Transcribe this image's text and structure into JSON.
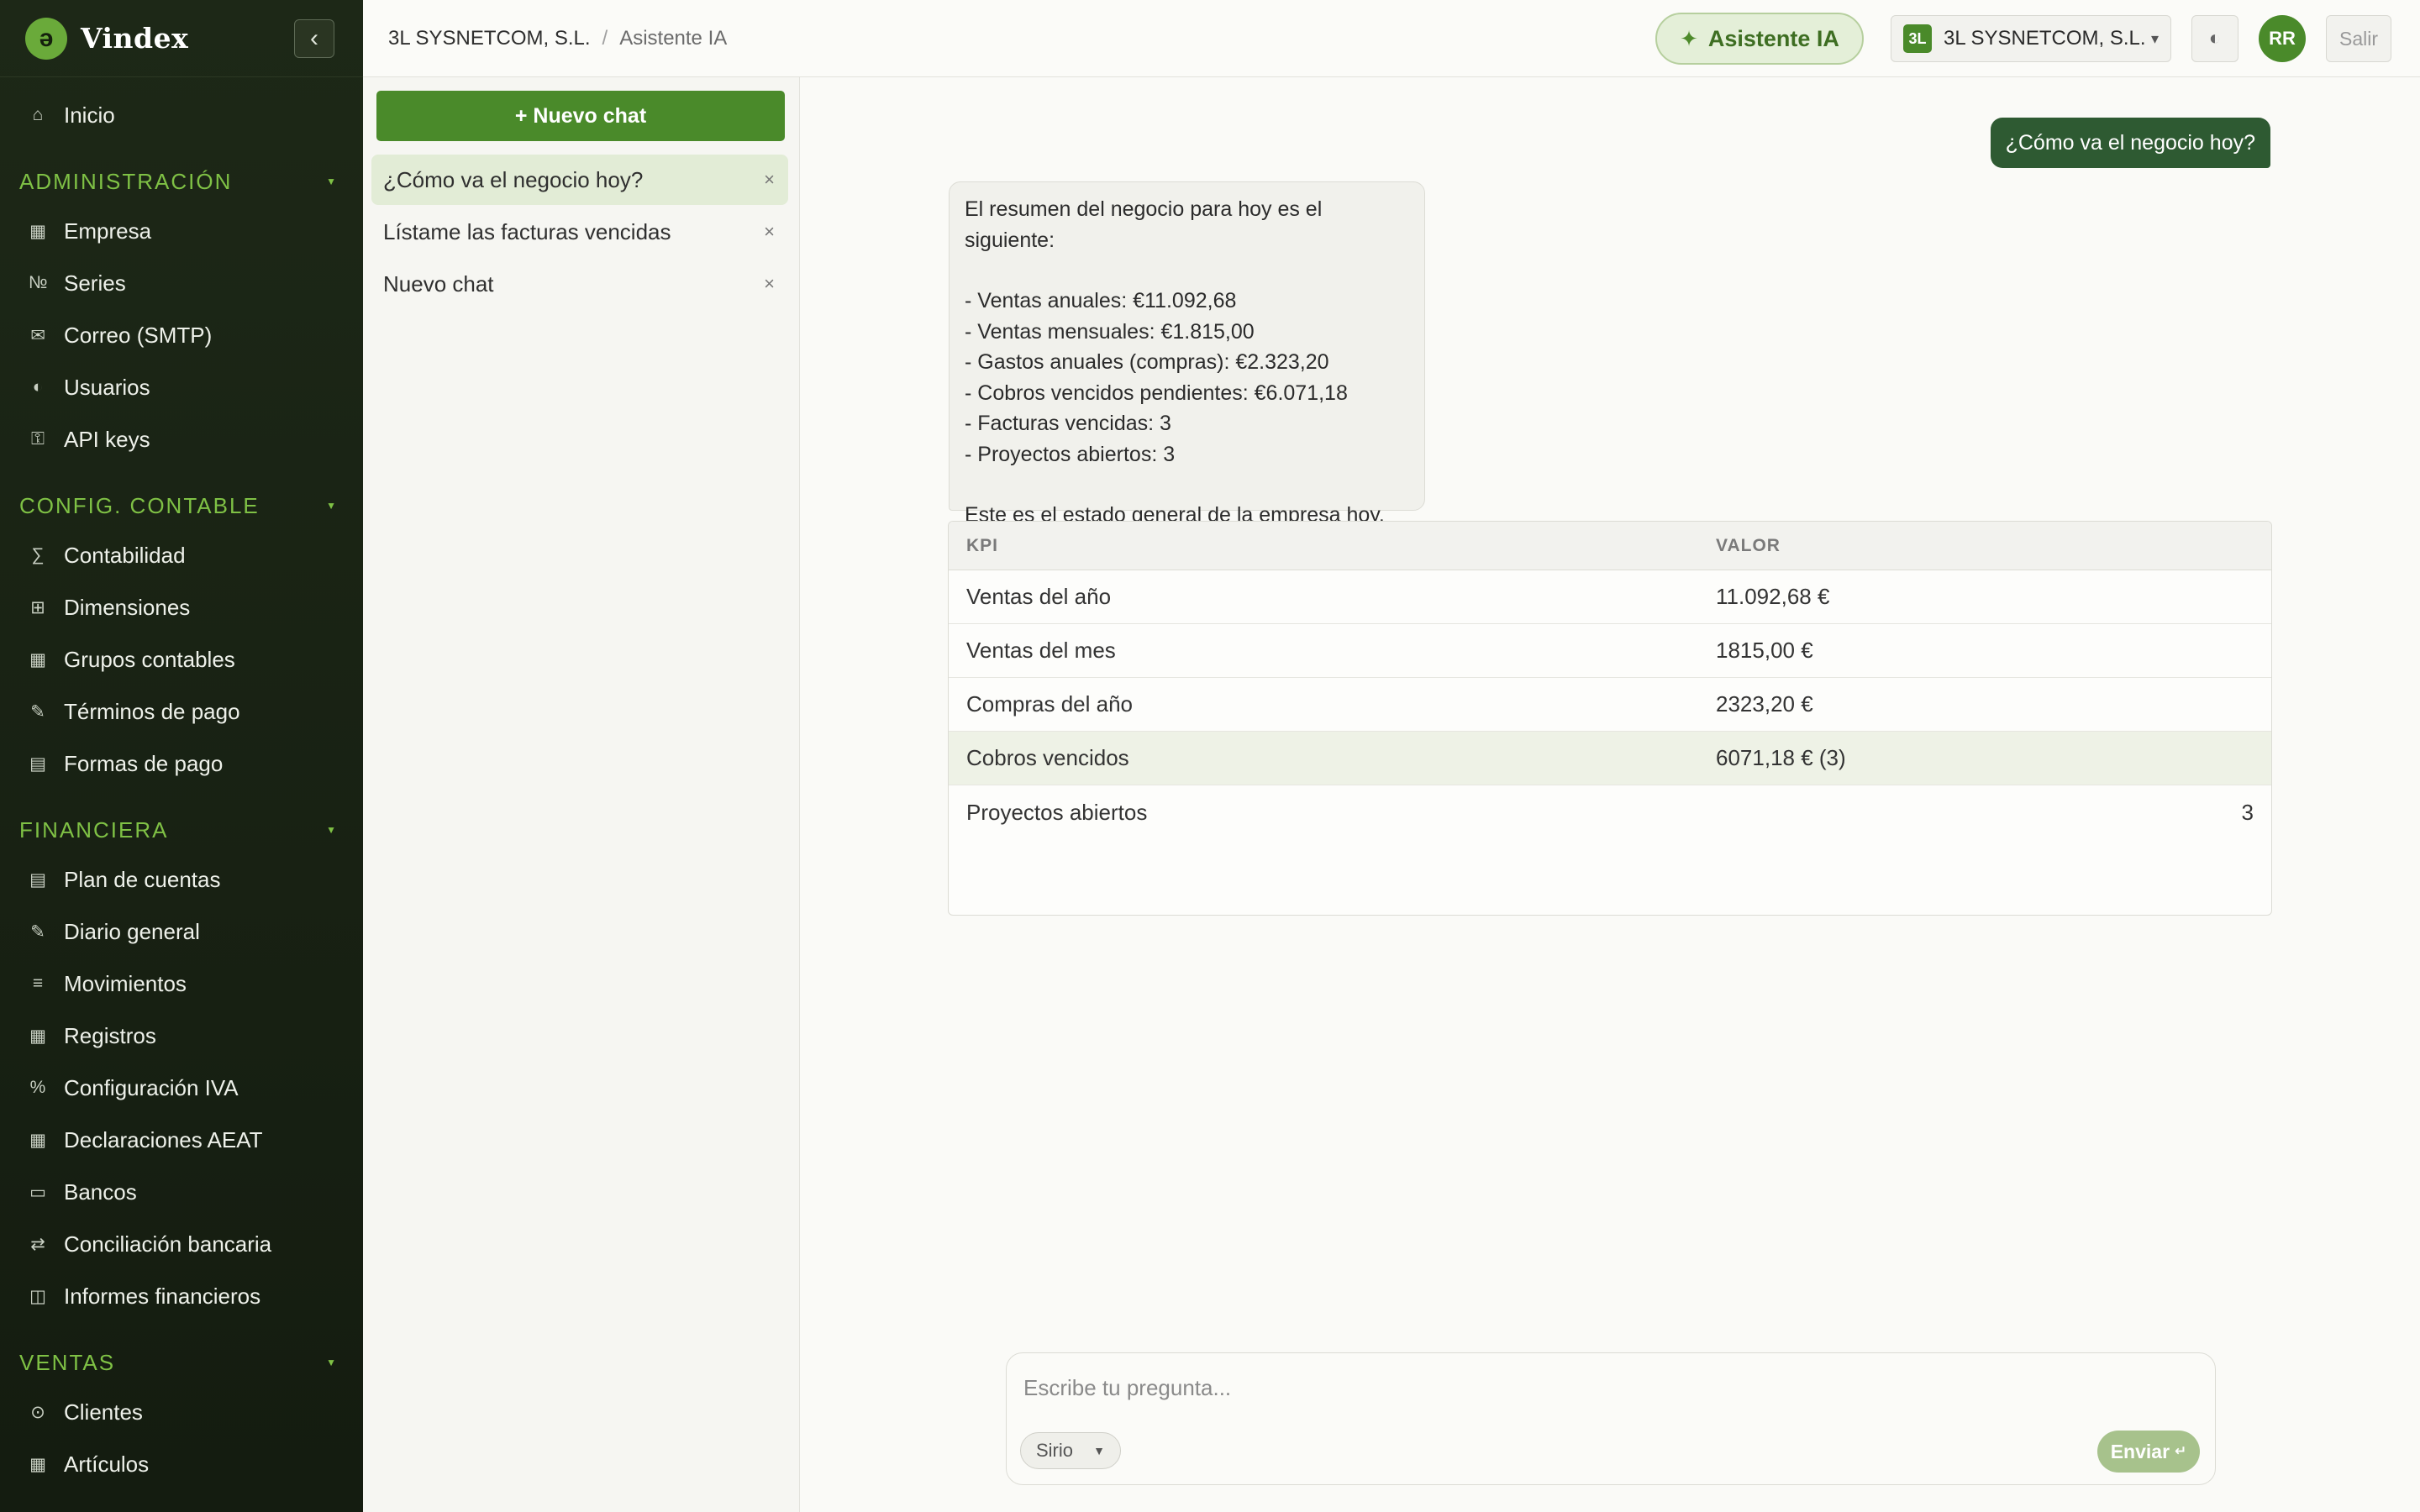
{
  "brand": {
    "name": "Vindex",
    "logo_letter": "ə"
  },
  "sidebar": {
    "home": {
      "icon": "⌂",
      "label": "Inicio"
    },
    "sections": [
      {
        "title": "ADMINISTRACIÓN",
        "items": [
          {
            "icon": "▦",
            "label": "Empresa"
          },
          {
            "icon": "№",
            "label": "Series"
          },
          {
            "icon": "✉",
            "label": "Correo (SMTP)"
          },
          {
            "icon": "◐",
            "label": "Usuarios"
          },
          {
            "icon": "⚿",
            "label": "API keys"
          }
        ]
      },
      {
        "title": "CONFIG. CONTABLE",
        "items": [
          {
            "icon": "∑",
            "label": "Contabilidad"
          },
          {
            "icon": "⊞",
            "label": "Dimensiones"
          },
          {
            "icon": "▦",
            "label": "Grupos contables"
          },
          {
            "icon": "✎",
            "label": "Términos de pago"
          },
          {
            "icon": "▤",
            "label": "Formas de pago"
          }
        ]
      },
      {
        "title": "FINANCIERA",
        "items": [
          {
            "icon": "▤",
            "label": "Plan de cuentas"
          },
          {
            "icon": "✎",
            "label": "Diario general"
          },
          {
            "icon": "≡",
            "label": "Movimientos"
          },
          {
            "icon": "▦",
            "label": "Registros"
          },
          {
            "icon": "%",
            "label": "Configuración IVA"
          },
          {
            "icon": "▦",
            "label": "Declaraciones AEAT"
          },
          {
            "icon": "▭",
            "label": "Bancos"
          },
          {
            "icon": "⇄",
            "label": "Conciliación bancaria"
          },
          {
            "icon": "◫",
            "label": "Informes financieros"
          }
        ]
      },
      {
        "title": "VENTAS",
        "items": [
          {
            "icon": "⊙",
            "label": "Clientes"
          },
          {
            "icon": "▦",
            "label": "Artículos"
          }
        ]
      }
    ]
  },
  "topbar": {
    "breadcrumb": {
      "company": "3L SYSNETCOM, S.L.",
      "separator": "/",
      "current": "Asistente IA"
    },
    "ai_button": "Asistente IA",
    "company_selector": {
      "badge": "3L",
      "name": "3L SYSNETCOM, S.L."
    },
    "avatar": "RR",
    "logout": "Salir"
  },
  "chats": {
    "new_chat": "+ Nuevo chat",
    "items": [
      {
        "title": "¿Cómo va el negocio hoy?",
        "active": true
      },
      {
        "title": "Lístame las facturas vencidas",
        "active": false
      },
      {
        "title": "Nuevo chat",
        "active": false
      }
    ],
    "close_glyph": "×"
  },
  "conversation": {
    "user_message": "¿Cómo va el negocio hoy?",
    "assistant_message": {
      "intro": "El resumen del negocio para hoy es el siguiente:",
      "bullets": [
        "- Ventas anuales: €11.092,68",
        "- Ventas mensuales: €1.815,00",
        "- Gastos anuales (compras): €2.323,20",
        "- Cobros vencidos pendientes: €6.071,18",
        "- Facturas vencidas: 3",
        "- Proyectos abiertos: 3"
      ],
      "outro": "Este es el estado general de la empresa hoy."
    },
    "kpi_table": {
      "headers": [
        "KPI",
        "VALOR"
      ],
      "rows": [
        {
          "kpi": "Ventas del año",
          "valor": "11.092,68 €"
        },
        {
          "kpi": "Ventas del mes",
          "valor": "1815,00 €"
        },
        {
          "kpi": "Compras del año",
          "valor": "2323,20 €"
        },
        {
          "kpi": "Cobros vencidos",
          "valor": "6071,18 € (3)"
        },
        {
          "kpi": "Proyectos abiertos",
          "valor": "3"
        }
      ]
    }
  },
  "composer": {
    "placeholder": "Escribe tu pregunta...",
    "value": "",
    "model": "Sirio",
    "send": "Enviar",
    "send_glyph": "↵"
  },
  "colors": {
    "sidebar_bg": "#1d2817",
    "accent": "#4a8a2a",
    "section_title": "#7fc145",
    "user_bubble": "#2e5a32"
  }
}
